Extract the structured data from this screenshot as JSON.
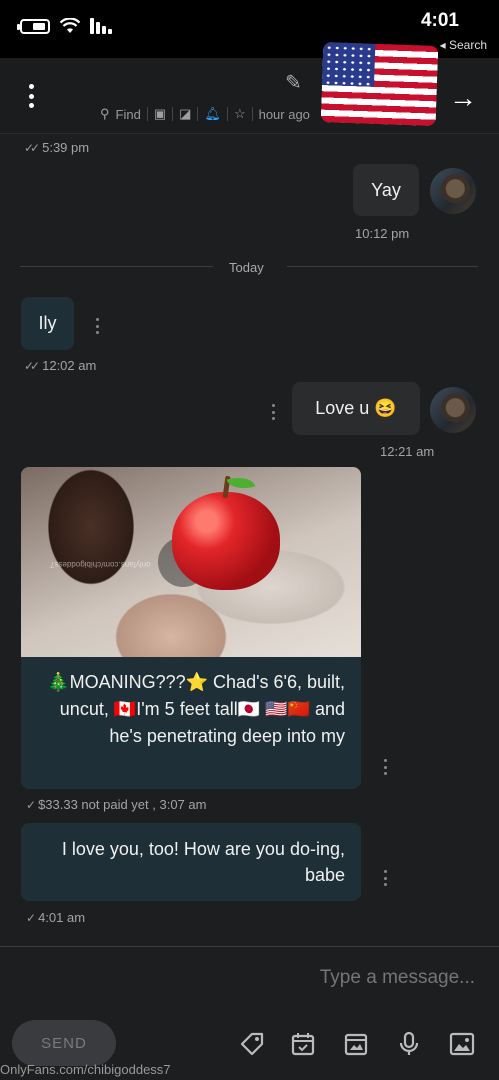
{
  "status_bar": {
    "time": "4:01",
    "back_label": "◂ Search"
  },
  "header": {
    "meta_text": "hour ago",
    "find_label": "Find"
  },
  "messages": {
    "first_time": "5:39 pm",
    "yay_text": "Yay",
    "yay_time": "10:12 pm",
    "divider_label": "Today",
    "ily_text": "Ily",
    "ily_time": "12:02 am",
    "love_text": "Love u 😆",
    "love_time": "12:21 am",
    "media_caption": "🎄MOANING???⭐ Chad's 6'6, built, uncut, 🇨🇦I'm 5 feet tall🇯🇵 🇺🇸🇨🇳 and he's penetrating deep into my",
    "media_meta": "$33.33 not paid yet , 3:07 am",
    "reply_text": "I love you, too! How are you do-ing, babe",
    "reply_time": "4:01 am",
    "media_watermark": "onlyfans.com/chibigoddess7"
  },
  "compose": {
    "placeholder": "Type a message...",
    "send_label": "SEND"
  },
  "footer": {
    "watermark": "OnlyFans.com/chibigoddess7"
  }
}
